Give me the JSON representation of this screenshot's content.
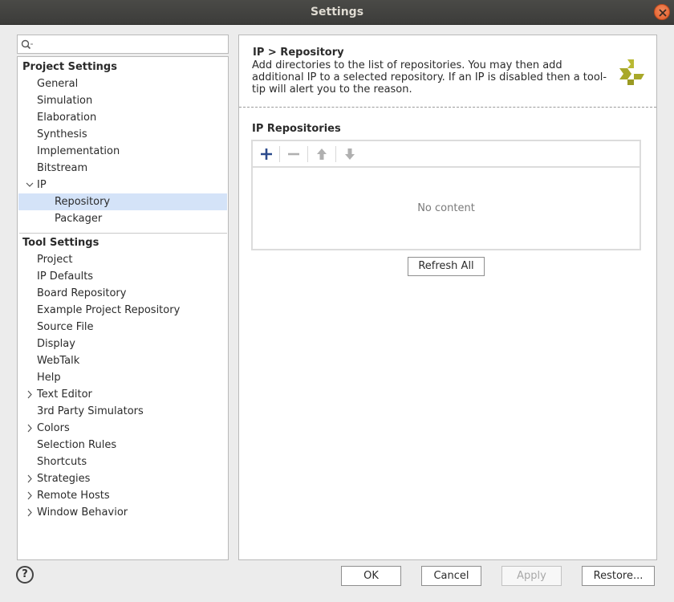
{
  "window": {
    "title": "Settings"
  },
  "search": {
    "placeholder": ""
  },
  "tree": {
    "project_header": "Project Settings",
    "project_items": [
      "General",
      "Simulation",
      "Elaboration",
      "Synthesis",
      "Implementation",
      "Bitstream",
      "IP",
      "Repository",
      "Packager"
    ],
    "tool_header": "Tool Settings",
    "tool_items": [
      "Project",
      "IP Defaults",
      "Board Repository",
      "Example Project Repository",
      "Source File",
      "Display",
      "WebTalk",
      "Help",
      "Text Editor",
      "3rd Party Simulators",
      "Colors",
      "Selection Rules",
      "Shortcuts",
      "Strategies",
      "Remote Hosts",
      "Window Behavior"
    ],
    "selected": "Repository"
  },
  "main": {
    "title": "IP > Repository",
    "description": "Add directories to the list of repositories. You may then add additional IP to a selected repository. If an IP is disabled then a tool-tip will alert you to the reason.",
    "section_title": "IP Repositories",
    "empty_text": "No content",
    "refresh_label": "Refresh All"
  },
  "footer": {
    "help_label": "?",
    "ok_label": "OK",
    "cancel_label": "Cancel",
    "apply_label": "Apply",
    "restore_label": "Restore..."
  },
  "colors": {
    "selection": "#d4e3f8",
    "logo": "#a8a82a",
    "add_icon": "#2b4a8c"
  }
}
